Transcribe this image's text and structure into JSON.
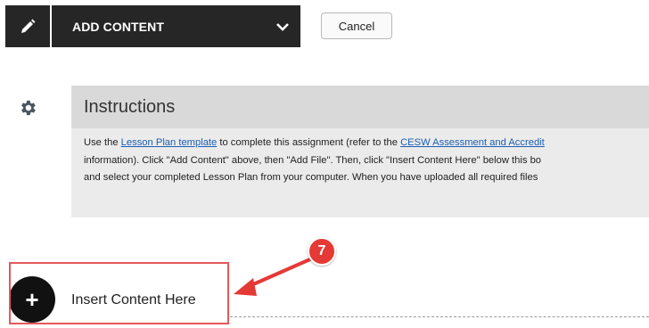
{
  "toolbar": {
    "edit_icon": "pencil-icon",
    "add_content_label": "ADD CONTENT",
    "dropdown_icon": "chevron-down-icon",
    "cancel_label": "Cancel"
  },
  "instructions": {
    "icon": "gear-icon",
    "title": "Instructions",
    "line1_pre": "Use the ",
    "line1_link1": "Lesson Plan template",
    "line1_mid": " to complete this assignment (refer to the ",
    "line1_link2": "CESW Assessment and Accredit",
    "line2": "information). Click \"Add Content\" above, then \"Add File\".  Then, click \"Insert Content Here\" below this bo",
    "line3": "and select your completed Lesson Plan from your computer.  When you have uploaded all required files"
  },
  "insert": {
    "plus_symbol": "+",
    "label": "Insert Content Here"
  },
  "annotation": {
    "step_number": "7",
    "color": "#e53935"
  }
}
